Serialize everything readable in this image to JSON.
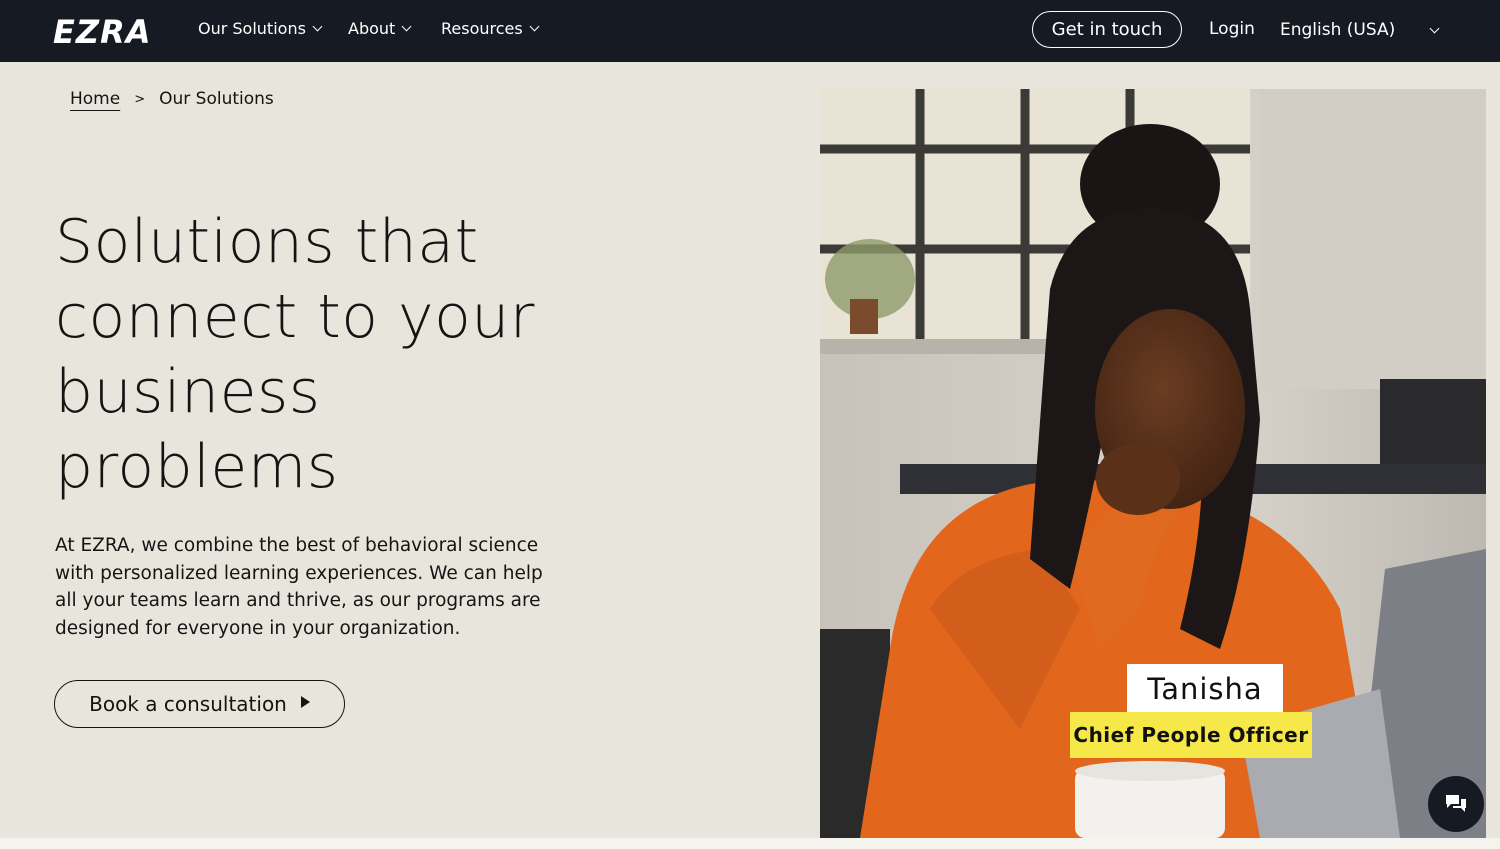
{
  "header": {
    "logo": "EZRA",
    "nav": [
      {
        "label": "Our Solutions"
      },
      {
        "label": "About"
      },
      {
        "label": "Resources"
      }
    ],
    "cta_label": "Get in touch",
    "login_label": "Login",
    "language": "English (USA)"
  },
  "breadcrumb": {
    "home": "Home",
    "separator": ">",
    "current": "Our Solutions"
  },
  "hero": {
    "title_lines": [
      "Solutions that",
      "connect to your",
      "business",
      "problems"
    ],
    "body": "At EZRA, we combine the best of behavioral science with personalized learning experiences. We can help all your teams learn and thrive, as our programs are designed for everyone in your organization.",
    "cta_label": "Book a consultation"
  },
  "feature": {
    "name": "Tanisha",
    "role": "Chief People Officer"
  },
  "colors": {
    "nav_bg": "#161a22",
    "page_bg": "#e8e6dc",
    "role_highlight": "#f7e84a",
    "sweater": "#e2661c"
  },
  "icons": [
    "chevron-down-icon",
    "play-icon",
    "chat-icon"
  ]
}
